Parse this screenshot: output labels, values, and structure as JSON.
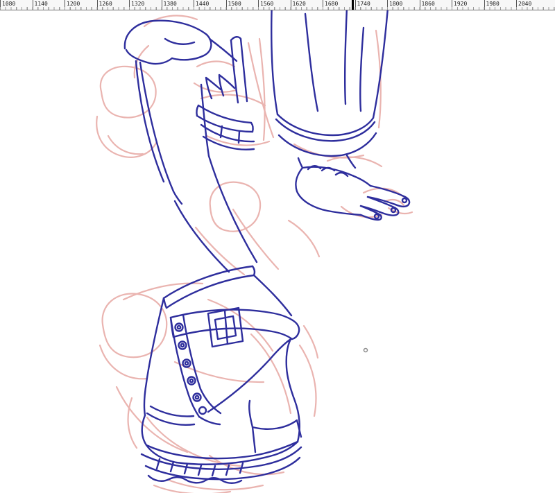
{
  "ruler": {
    "labels": [
      "1080",
      "1140",
      "1200",
      "1260",
      "1320",
      "1380",
      "1440",
      "1500",
      "1560",
      "1620",
      "1680",
      "1740",
      "1800",
      "1860",
      "1920",
      "1980",
      "2040"
    ],
    "cursor_value": "1740"
  },
  "colors": {
    "ink": "#2e2e9d",
    "sketch": "#eab4b0",
    "dot": "#8a8a8a",
    "ruler_cursor": "#000000"
  },
  "canvas": {
    "description": "line-art of a bent leg wearing a buckled boot, hanging sleeve cuff and hand, over pink rough sketch"
  }
}
